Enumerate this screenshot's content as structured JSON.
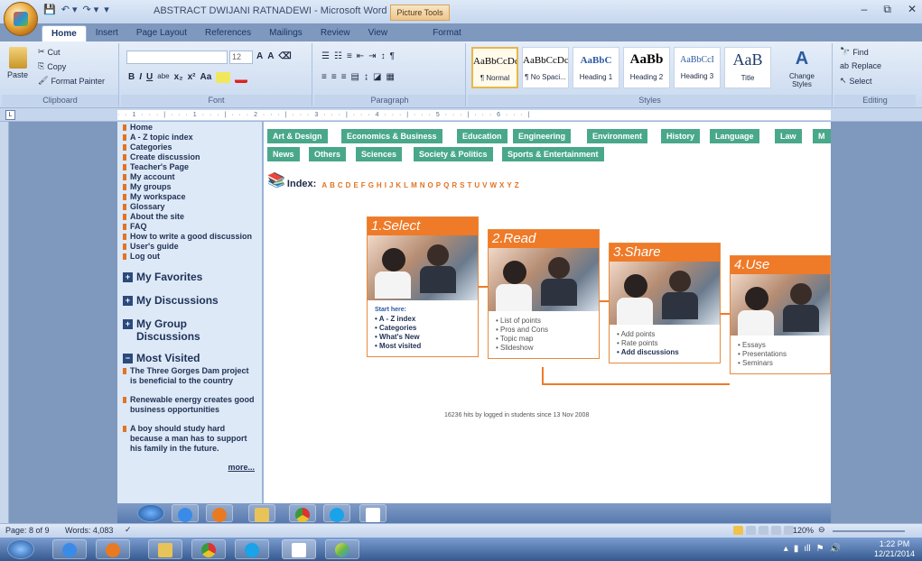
{
  "window": {
    "title": "ABSTRACT DWIJANI RATNADEWI - Microsoft Word",
    "context_tab": "Picture Tools",
    "controls": [
      "–",
      "⧉",
      "✕"
    ]
  },
  "qat": [
    "💾",
    "↶ ▾",
    "↷ ▾",
    "▾"
  ],
  "tabs": [
    "Home",
    "Insert",
    "Page Layout",
    "References",
    "Mailings",
    "Review",
    "View",
    "Format"
  ],
  "clipboard": {
    "paste": "Paste",
    "cut": "Cut",
    "copy": "Copy",
    "format_painter": "Format Painter",
    "label": "Clipboard"
  },
  "font": {
    "name": "",
    "size": "12",
    "label": "Font",
    "row2": [
      "B",
      "I",
      "U",
      "abe",
      "x₂",
      "x²",
      "Aa"
    ]
  },
  "paragraph": {
    "label": "Paragraph"
  },
  "styles": {
    "label": "Styles",
    "items": [
      {
        "sample": "AaBbCcDc",
        "name": "¶ Normal"
      },
      {
        "sample": "AaBbCcDc",
        "name": "¶ No Spaci..."
      },
      {
        "sample": "AaBbC",
        "name": "Heading 1"
      },
      {
        "sample": "AaBb",
        "name": "Heading 2"
      },
      {
        "sample": "AaBbCcI",
        "name": "Heading 3"
      },
      {
        "sample": "AaB",
        "name": "Title"
      }
    ],
    "change": "Change Styles"
  },
  "editing": {
    "find": "Find",
    "replace": "Replace",
    "select": "Select",
    "label": "Editing"
  },
  "ruler": "· · 1 · · · | · · · 1 · · · | · · · 2 · · · | · · · 3 · · · | · · · 4 · · · | · · · 5 · · · | · · · 6 · · · |",
  "sidebar": {
    "links": [
      "Home",
      "A - Z topic index",
      "Categories",
      "Create discussion",
      "Teacher's Page",
      "My account",
      "My groups",
      "My workspace",
      "Glossary",
      "About the site",
      "FAQ",
      "How to write a good discussion",
      "User's guide",
      "Log out"
    ],
    "favorites": "My Favorites",
    "discussions": "My Discussions",
    "group_discussions": "My Group Discussions",
    "most_visited": "Most Visited",
    "mv_items": [
      "The Three Gorges Dam project is beneficial to the country",
      "Renewable energy creates good business opportunities",
      "A boy should study hard because a man has to support his family in the future."
    ],
    "more": "more..."
  },
  "categories_row1": [
    "Art & Design",
    "Economics & Business",
    "Education",
    "Engineering",
    "Environment",
    "History",
    "Language",
    "Law",
    "M"
  ],
  "categories_row2": [
    "News",
    "Others",
    "Sciences",
    "Society & Politics",
    "Sports & Entertainment"
  ],
  "index": {
    "label": "Index:",
    "letters": [
      "A",
      "B",
      "C",
      "D",
      "E",
      "F",
      "G",
      "H",
      "I",
      "J",
      "K",
      "L",
      "M",
      "N",
      "O",
      "P",
      "Q",
      "R",
      "S",
      "T",
      "U",
      "V",
      "W",
      "X",
      "Y",
      "Z"
    ]
  },
  "steps": [
    {
      "title": "1.Select",
      "start": "Start here:",
      "items": [
        "A - Z index",
        "Categories",
        "What's New",
        "Most visited"
      ]
    },
    {
      "title": "2.Read",
      "items": [
        "List of points",
        "Pros and Cons",
        "Topic map",
        "Slideshow"
      ]
    },
    {
      "title": "3.Share",
      "items": [
        "Add points",
        "Rate points",
        "Add discussions"
      ]
    },
    {
      "title": "4.Use",
      "items": [
        "Essays",
        "Presentations",
        "Seminars"
      ]
    }
  ],
  "hits": "16236 hits by logged in students since 13 Nov 2008",
  "status": {
    "page": "Page: 8 of 9",
    "words": "Words: 4,083",
    "zoom": "120%"
  },
  "clock": {
    "time": "1:22 PM",
    "date": "12/21/2014"
  },
  "colors": {
    "accent": "#ef7a28",
    "category": "#4aa88a",
    "ribbon": "#c9d9ef"
  }
}
